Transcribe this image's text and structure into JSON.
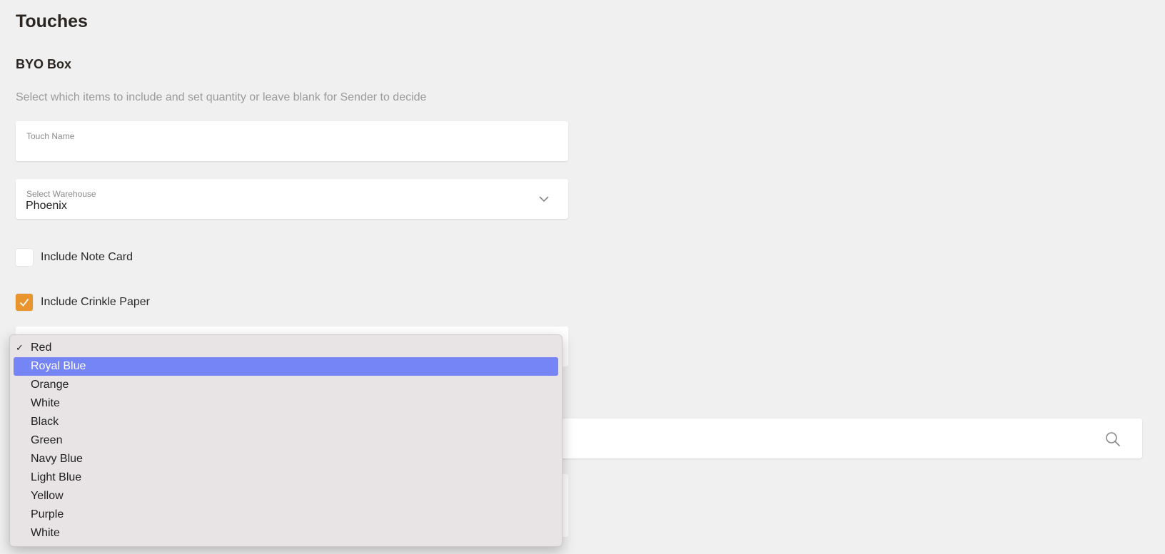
{
  "page": {
    "title": "Touches"
  },
  "byo": {
    "section_title": "BYO Box",
    "hint": "Select which items to include and set quantity or leave blank for Sender to decide"
  },
  "touch_name": {
    "label": "Touch Name",
    "value": ""
  },
  "warehouse": {
    "label": "Select Warehouse",
    "value": "Phoenix"
  },
  "note_card": {
    "label": "Include Note Card",
    "checked": false
  },
  "crinkle_paper": {
    "label": "Include Crinkle Paper",
    "checked": true
  },
  "crinkle_color": {
    "selected": "Red",
    "highlighted": "Royal Blue",
    "options": [
      "Red",
      "Royal Blue",
      "Orange",
      "White",
      "Black",
      "Green",
      "Navy Blue",
      "Light Blue",
      "Yellow",
      "Purple",
      "White"
    ]
  },
  "colors": {
    "accent": "#e8952e",
    "highlight": "#7585f5"
  },
  "icons": {
    "select_caret": "chevron-down-icon",
    "search": "search-icon",
    "checkmark": "check-icon"
  }
}
